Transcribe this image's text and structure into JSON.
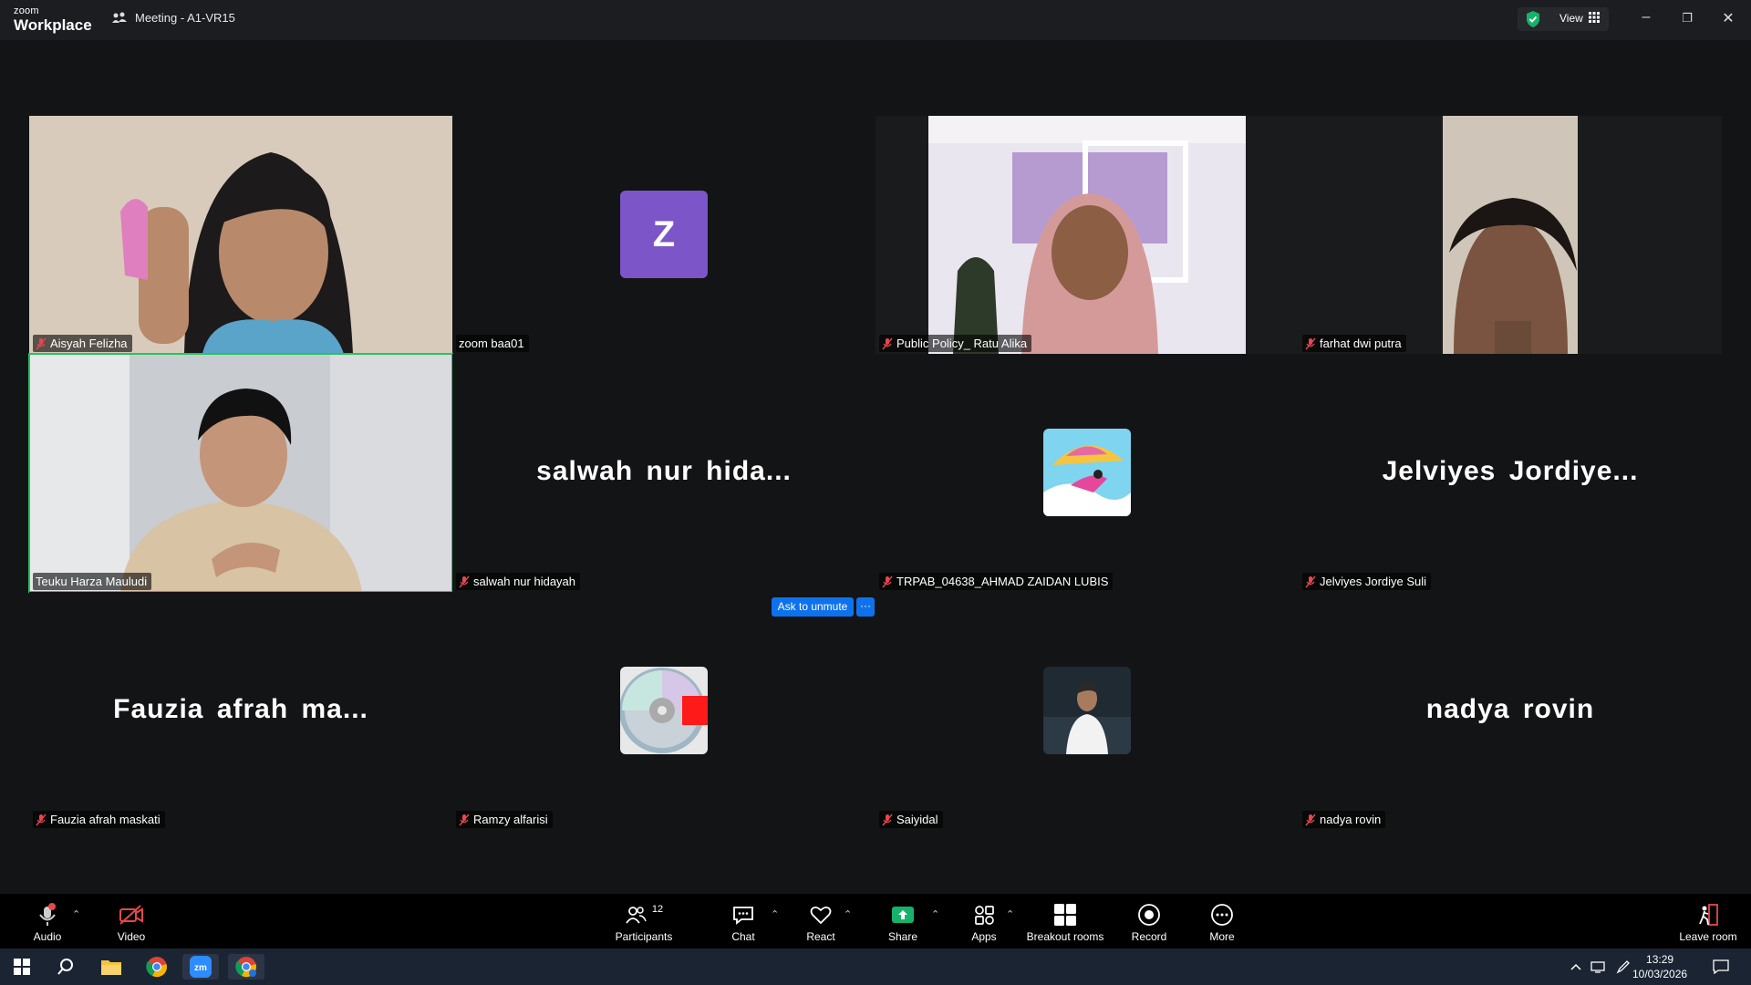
{
  "app": {
    "brand_top": "zoom",
    "brand_bottom": "Workplace",
    "meeting_title": "Meeting - A1-VR15",
    "view_label": "View"
  },
  "tiles": [
    {
      "name": "Aisyah Felizha",
      "kind": "video"
    },
    {
      "name": "zoom baa01",
      "kind": "avatar-letter",
      "letter": "Z"
    },
    {
      "name": "Public Policy_ Ratu Alika",
      "kind": "video"
    },
    {
      "name": "farhat dwi putra",
      "kind": "video"
    },
    {
      "name": "Teuku Harza Mauludi",
      "kind": "video",
      "active_speaker": true
    },
    {
      "name": "salwah nur hidayah",
      "kind": "name",
      "display": "salwah nur hida..."
    },
    {
      "name": "TRPAB_04638_AHMAD ZAIDAN LUBIS",
      "kind": "avatar-image"
    },
    {
      "name": "Jelviyes Jordiye Suli",
      "kind": "name",
      "display": "Jelviyes Jordiye..."
    },
    {
      "name": "Fauzia afrah maskati",
      "kind": "name",
      "display": "Fauzia afrah ma..."
    },
    {
      "name": "Ramzy alfarisi",
      "kind": "avatar-image"
    },
    {
      "name": "Saiyidal",
      "kind": "avatar-image"
    },
    {
      "name": "nadya rovin",
      "kind": "name",
      "display": "nadya rovin"
    }
  ],
  "overlay": {
    "ask_to_unmute": "Ask to unmute",
    "more": "···"
  },
  "toolbar": {
    "audio": "Audio",
    "video": "Video",
    "participants": "Participants",
    "participants_count": "12",
    "chat": "Chat",
    "react": "React",
    "share": "Share",
    "apps": "Apps",
    "breakout": "Breakout rooms",
    "record": "Record",
    "more": "More",
    "leave": "Leave room"
  },
  "taskbar": {
    "time": "13:29",
    "date": "10/03/2026"
  },
  "colors": {
    "accent": "#0e72ed",
    "active_border": "#22c55e",
    "mute_red": "#e5484d",
    "share_green": "#17b26a"
  }
}
